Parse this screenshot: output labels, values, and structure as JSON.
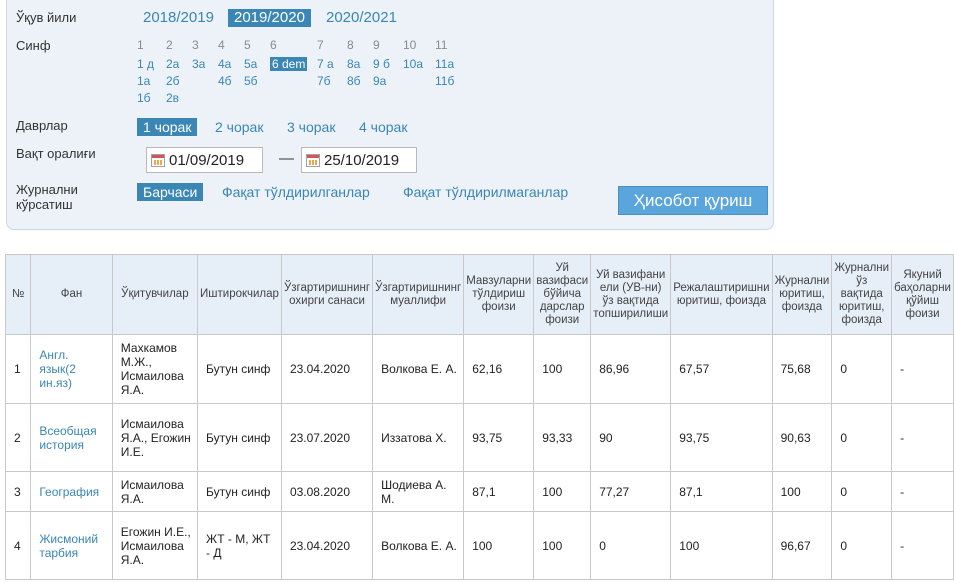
{
  "filters": {
    "year_label": "Ўқув йили",
    "years": [
      "2018/2019",
      "2019/2020",
      "2020/2021"
    ],
    "class_label": "Синф",
    "grades": [
      "1",
      "2",
      "3",
      "4",
      "5",
      "6",
      "7",
      "8",
      "9",
      "10",
      "11"
    ],
    "classes": {
      "g1": [
        "1 д",
        "1а",
        "1б"
      ],
      "g2": [
        "2а",
        "2б",
        "2в"
      ],
      "g3": [
        "3а"
      ],
      "g4": [
        "4а",
        "4б"
      ],
      "g5": [
        "5а",
        "5б"
      ],
      "g6": [
        "6 dem"
      ],
      "g7": [
        "7 а",
        "7б"
      ],
      "g8": [
        "8а",
        "8б"
      ],
      "g9": [
        "9 б",
        "9а"
      ],
      "g10": [
        "10а"
      ],
      "g11": [
        "11а",
        "11б"
      ]
    },
    "period_label": "Даврлар",
    "quarters": [
      "1 чорак",
      "2 чорак",
      "3 чорак",
      "4 чорак"
    ],
    "time_range_label": "Вақт оралиғи",
    "date_from": "01/09/2019",
    "date_sep": "—",
    "date_to": "25/10/2019",
    "journal_label_1": "Журнални",
    "journal_label_2": "кўрсатиш",
    "journal_options": [
      "Барчаси",
      "Фақат тўлдирилганлар",
      "Фақат тўлдирилмаганлар"
    ],
    "report_button": "Ҳисобот қуриш"
  },
  "table": {
    "headers": [
      "№",
      "Фан",
      "Ўқитувчилар",
      "Иштирокчилар",
      "Ўзгартиришнинг охирги санаси",
      "Ўзгартиришнинг муаллифи",
      "Мавзуларни тўлдириш фоизи",
      "Уй вазифаси бўйича дарслар фоизи",
      "Уй вазифани ели (УВ-ни) ўз вақтида топширилиши",
      "Режалаштиришни юритиш, фоизда",
      "Журнални юритиш, фоизда",
      "Журнални ўз вақтида юритиш, фоизда",
      "Якуний баҳоларни қўйиш фоизи"
    ],
    "rows": [
      {
        "n": "1",
        "subject": "Англ. язык(2 ин.яз)",
        "teachers": "Махкамов М.Ж., Исмаилова Я.А.",
        "participants": "Бутун синф",
        "date": "23.04.2020",
        "author": "Волкова Е. А.",
        "topics": "62,16",
        "hw_lessons": "100",
        "hw_ontime": "86,96",
        "planning": "67,57",
        "journal": "75,68",
        "journal_ontime": "0",
        "final": "-"
      },
      {
        "n": "2",
        "subject": "Всеобщая история",
        "teachers": "Исмаилова Я.А., Егожин И.Е.",
        "participants": "Бутун синф",
        "date": "23.07.2020",
        "author": "Иззатова Х.",
        "topics": "93,75",
        "hw_lessons": "93,33",
        "hw_ontime": "90",
        "planning": "93,75",
        "journal": "90,63",
        "journal_ontime": "0",
        "final": "-"
      },
      {
        "n": "3",
        "subject": "География",
        "teachers": "Исмаилова Я.А.",
        "participants": "Бутун синф",
        "date": "03.08.2020",
        "author": "Шодиева А. М.",
        "topics": "87,1",
        "hw_lessons": "100",
        "hw_ontime": "77,27",
        "planning": "87,1",
        "journal": "100",
        "journal_ontime": "0",
        "final": "-"
      },
      {
        "n": "4",
        "subject": "Жисмоний тарбия",
        "teachers": "Егожин И.Е., Исмаилова Я.А.",
        "participants": "ЖТ - М, ЖТ - Д",
        "date": "23.04.2020",
        "author": "Волкова Е. А.",
        "topics": "100",
        "hw_lessons": "100",
        "hw_ontime": "0",
        "planning": "100",
        "journal": "96,67",
        "journal_ontime": "0",
        "final": "-"
      }
    ]
  },
  "colors": {
    "accent": "#3a86b4",
    "button": "#5aa5dc",
    "panel": "#edf2f9",
    "header": "#e6eef7"
  }
}
